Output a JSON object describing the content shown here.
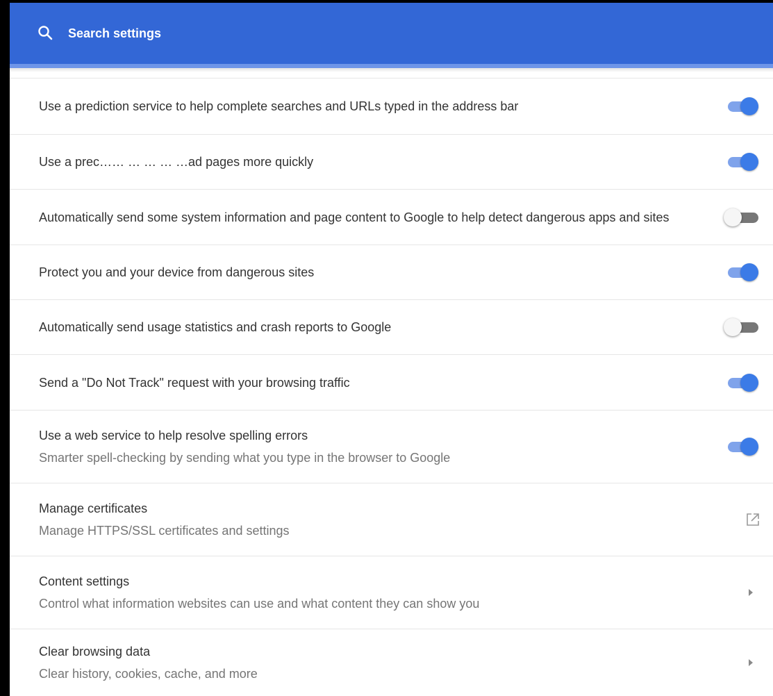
{
  "search": {
    "placeholder": "Search settings",
    "icon": "search-icon"
  },
  "colors": {
    "header": "#3367d6",
    "toggle_on": "#3b7be7",
    "toggle_off": "#777777"
  },
  "rows": [
    {
      "label": "Use a prediction service to help complete searches and URLs typed in the address bar",
      "control": "toggle",
      "checked": true
    },
    {
      "label": "Use a prec…… … … … …ad pages more quickly",
      "control": "toggle",
      "checked": true
    },
    {
      "label": "Automatically send some system information and page content to Google to help detect dangerous apps and sites",
      "control": "toggle",
      "checked": false
    },
    {
      "label": "Protect you and your device from dangerous sites",
      "control": "toggle",
      "checked": true
    },
    {
      "label": "Automatically send usage statistics and crash reports to Google",
      "control": "toggle",
      "checked": false
    },
    {
      "label": "Send a \"Do Not Track\" request with your browsing traffic",
      "control": "toggle",
      "checked": true
    },
    {
      "label": "Use a web service to help resolve spelling errors",
      "sublabel": "Smarter spell-checking by sending what you type in the browser to Google",
      "control": "toggle",
      "checked": true
    },
    {
      "label": "Manage certificates",
      "sublabel": "Manage HTTPS/SSL certificates and settings",
      "control": "external-link-icon"
    },
    {
      "label": "Content settings",
      "sublabel": "Control what information websites can use and what content they can show you",
      "control": "chevron-right-icon"
    },
    {
      "label": "Clear browsing data",
      "sublabel": "Clear history, cookies, cache, and more",
      "control": "chevron-right-icon"
    }
  ]
}
